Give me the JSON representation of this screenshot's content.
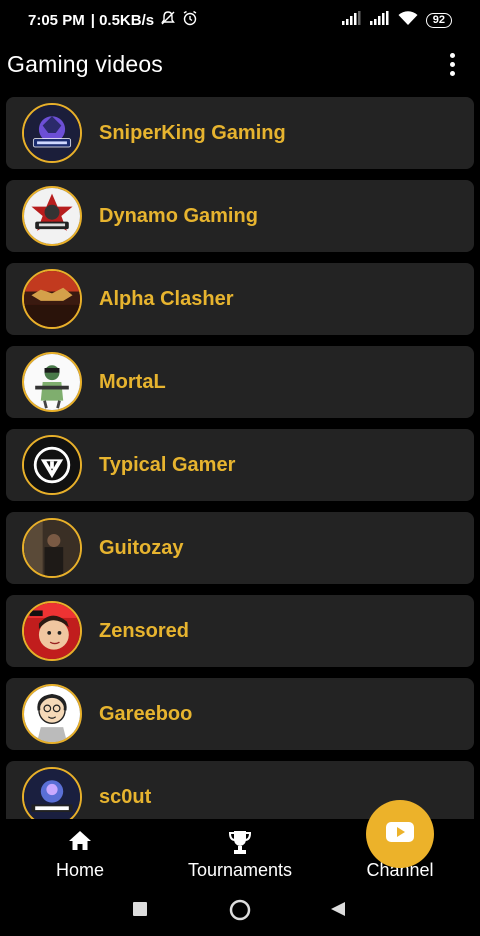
{
  "status_bar": {
    "time": "7:05 PM",
    "net_speed": "| 0.5KB/s",
    "battery": "92"
  },
  "app_bar": {
    "title": "Gaming videos",
    "menu_icon": "more-vert-icon"
  },
  "channels": [
    {
      "name": "SniperKing Gaming",
      "avatar": "sniperking-logo"
    },
    {
      "name": "Dynamo Gaming",
      "avatar": "dynamo-logo"
    },
    {
      "name": "Alpha Clasher",
      "avatar": "alpha-clasher-logo"
    },
    {
      "name": "MortaL",
      "avatar": "mortal-logo"
    },
    {
      "name": "Typical Gamer",
      "avatar": "typical-gamer-logo"
    },
    {
      "name": "Guitozay",
      "avatar": "guitozay-photo"
    },
    {
      "name": "Zensored",
      "avatar": "zensored-logo"
    },
    {
      "name": "Gareeboo",
      "avatar": "gareeboo-logo"
    },
    {
      "name": "sc0ut",
      "avatar": "scout-logo"
    }
  ],
  "bottom_nav": {
    "home": "Home",
    "tournaments": "Tournaments",
    "channel": "Channel"
  },
  "colors": {
    "accent": "#e7b42f",
    "card_bg": "#232323",
    "background": "#000000",
    "fab": "#ecb22a"
  }
}
